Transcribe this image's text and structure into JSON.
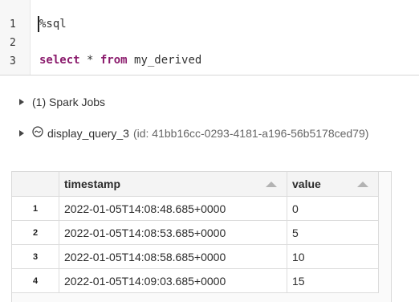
{
  "editor": {
    "line_numbers": [
      "1",
      "2",
      "3"
    ],
    "line1": "%sql",
    "line3_kw1": "select",
    "line3_mid": " * ",
    "line3_kw2": "from",
    "line3_tail": " my_derived"
  },
  "jobs": {
    "label": "(1) Spark Jobs",
    "icon": "triangle-right-icon"
  },
  "query": {
    "name": "display_query_3",
    "id_text": "(id: 41bb16cc-0293-4181-a196-56b5178ced79)",
    "icons": [
      "triangle-right-icon",
      "stream-circle-icon"
    ]
  },
  "table": {
    "columns": [
      "timestamp",
      "value"
    ],
    "rows": [
      {
        "index": "1",
        "timestamp": "2022-01-05T14:08:48.685+0000",
        "value": "0"
      },
      {
        "index": "2",
        "timestamp": "2022-01-05T14:08:53.685+0000",
        "value": "5"
      },
      {
        "index": "3",
        "timestamp": "2022-01-05T14:08:58.685+0000",
        "value": "10"
      },
      {
        "index": "4",
        "timestamp": "2022-01-05T14:09:03.685+0000",
        "value": "15"
      }
    ]
  },
  "colors": {
    "keyword": "#8a1a6c",
    "sort_arrow": "#b3b3b3"
  }
}
